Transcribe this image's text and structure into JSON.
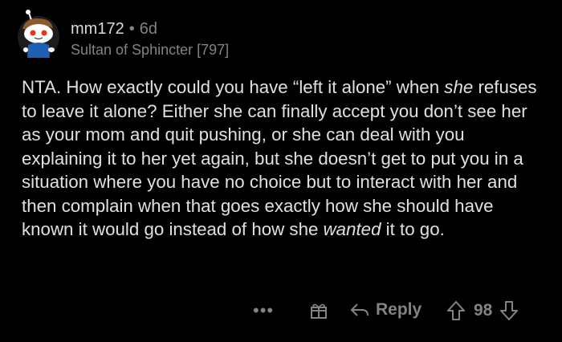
{
  "comment": {
    "username": "mm172",
    "separator": "•",
    "age": "6d",
    "flair": "Sultan of Sphincter [797]",
    "body": {
      "part1": "NTA.  How exactly could you have “left it alone” when ",
      "em1": "she",
      "part2": " refuses to leave it alone?  Either she can finally accept you don’t see her as your mom and quit pushing, or she can deal with you explaining it to her yet again, but she doesn’t get to put you in a situation where you have no choice but to interact with her and then complain when that goes exactly how she should have known it would go instead of how she ",
      "em2": "wanted",
      "part3": " it to go."
    }
  },
  "actions": {
    "more_label": "•••",
    "reply_label": "Reply",
    "score": "98"
  },
  "icons": {
    "more": "more-options-icon",
    "award": "award-gift-icon",
    "reply": "reply-arrow-icon",
    "upvote": "upvote-arrow-icon",
    "downvote": "downvote-arrow-icon"
  },
  "colors": {
    "background": "#000000",
    "text": "#e0e0e0",
    "muted": "#818384",
    "avatar_bg": "#1c1c1c"
  }
}
